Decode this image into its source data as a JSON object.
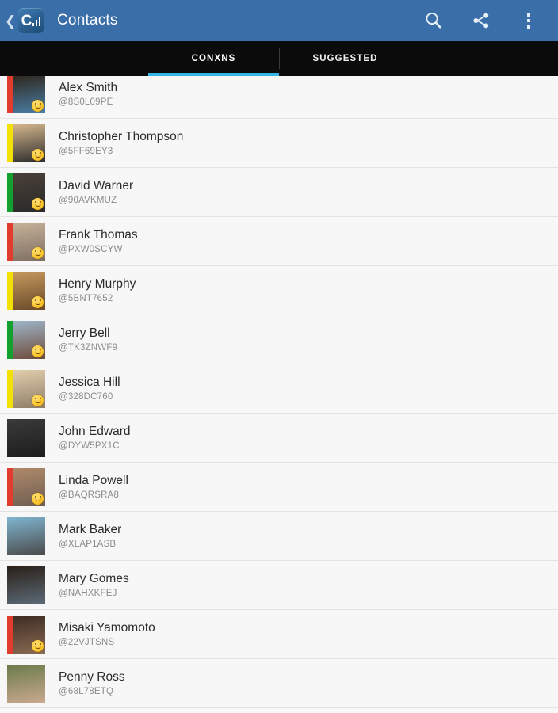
{
  "actionbar": {
    "back_icon": "back-chevron-icon",
    "app_icon_letter": "C",
    "title": "Contacts",
    "actions": [
      {
        "name": "search-button",
        "icon": "search-icon"
      },
      {
        "name": "share-button",
        "icon": "share-icon"
      },
      {
        "name": "overflow-menu-button",
        "icon": "more-vertical-icon"
      }
    ],
    "background_color": "#3a6ea8"
  },
  "tabs": {
    "active_index": 0,
    "indicator_color": "#33b5e5",
    "background_color": "#0b0b0b",
    "items": [
      {
        "label": "CONXNS"
      },
      {
        "label": "SUGGESTED"
      }
    ]
  },
  "list": {
    "background_color": "#f7f7f7",
    "separator_color": "#e3e3e3",
    "contacts": [
      {
        "name": "Alex Smith",
        "handle": "@8S0L09PE",
        "stripe": "#e23c2e",
        "badge": true,
        "photo_top": "#2e2418",
        "photo_bottom": "#4a7fa8"
      },
      {
        "name": "Christopher Thompson",
        "handle": "@5FF69EY3",
        "stripe": "#f2e007",
        "badge": true,
        "photo_top": "#d8b98f",
        "photo_bottom": "#2b2b2b"
      },
      {
        "name": "David Warner",
        "handle": "@90AVKMUZ",
        "stripe": "#14a02e",
        "badge": true,
        "photo_top": "#4b4038",
        "photo_bottom": "#2a2a2a"
      },
      {
        "name": "Frank Thomas",
        "handle": "@PXW0SCYW",
        "stripe": "#e23c2e",
        "badge": true,
        "photo_top": "#c9b49b",
        "photo_bottom": "#7e6f63"
      },
      {
        "name": "Henry Murphy",
        "handle": "@5BNT7652",
        "stripe": "#f2e007",
        "badge": true,
        "photo_top": "#c79a5e",
        "photo_bottom": "#6b4a2a"
      },
      {
        "name": "Jerry Bell",
        "handle": "@TK3ZNWF9",
        "stripe": "#14a02e",
        "badge": true,
        "photo_top": "#9fb8cc",
        "photo_bottom": "#6d4a3a"
      },
      {
        "name": "Jessica Hill",
        "handle": "@328DC760",
        "stripe": "#f2e007",
        "badge": true,
        "photo_top": "#e4cfae",
        "photo_bottom": "#8e7e68"
      },
      {
        "name": "John Edward",
        "handle": "@DYW5PX1C",
        "stripe": "",
        "badge": false,
        "photo_top": "#3a3a3a",
        "photo_bottom": "#1d1d1d"
      },
      {
        "name": "Linda Powell",
        "handle": "@BAQRSRA8",
        "stripe": "#e23c2e",
        "badge": true,
        "photo_top": "#b08a6a",
        "photo_bottom": "#6e5e52"
      },
      {
        "name": "Mark Baker",
        "handle": "@XLAP1ASB",
        "stripe": "",
        "badge": false,
        "photo_top": "#7fb4cf",
        "photo_bottom": "#4a4a4a"
      },
      {
        "name": "Mary Gomes",
        "handle": "@NAHXKFEJ",
        "stripe": "",
        "badge": false,
        "photo_top": "#2a2018",
        "photo_bottom": "#5c6b78"
      },
      {
        "name": "Misaki Yamomoto",
        "handle": "@22VJTSNS",
        "stripe": "#e23c2e",
        "badge": true,
        "photo_top": "#3a2a22",
        "photo_bottom": "#8a6a52"
      },
      {
        "name": "Penny Ross",
        "handle": "@68L78ETQ",
        "stripe": "",
        "badge": false,
        "photo_top": "#6b7a4a",
        "photo_bottom": "#c9a98f"
      }
    ]
  }
}
